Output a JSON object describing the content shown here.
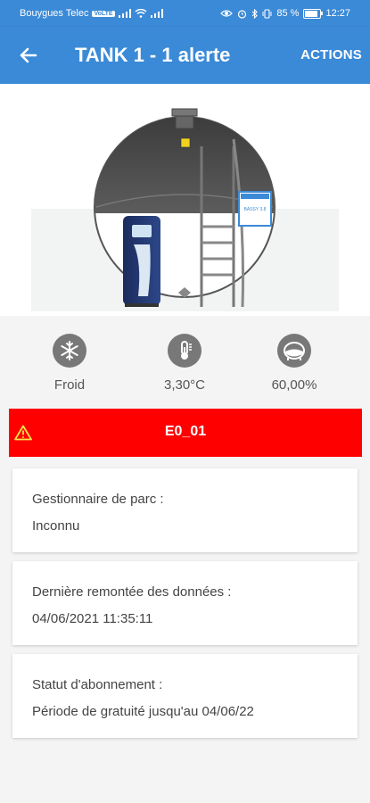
{
  "status_bar": {
    "carrier": "Bouygues Telec",
    "volte": "VoLTE",
    "battery_text": "85 %",
    "battery_level": 0.85,
    "time": "12:27"
  },
  "app_bar": {
    "title": "TANK 1 - 1 alerte",
    "actions_label": "ACTIONS"
  },
  "tank_illustration": {
    "plate_text": "BASSY 3.8"
  },
  "metrics": [
    {
      "icon": "snowflake-icon",
      "label": "Froid"
    },
    {
      "icon": "thermometer-icon",
      "label": "3,30°C"
    },
    {
      "icon": "tank-level-icon",
      "label": "60,00%"
    }
  ],
  "alert": {
    "code": "E0_01",
    "color": "#ff0000"
  },
  "cards": [
    {
      "label": "Gestionnaire de parc :",
      "value": "Inconnu"
    },
    {
      "label": "Dernière remontée des données :",
      "value": "04/06/2021 11:35:11"
    },
    {
      "label": "Statut d'abonnement :",
      "value": "Période de gratuité jusqu'au 04/06/22"
    }
  ],
  "colors": {
    "primary": "#3b8ad7",
    "alert": "#ff0000",
    "icon_bg": "#787878"
  }
}
